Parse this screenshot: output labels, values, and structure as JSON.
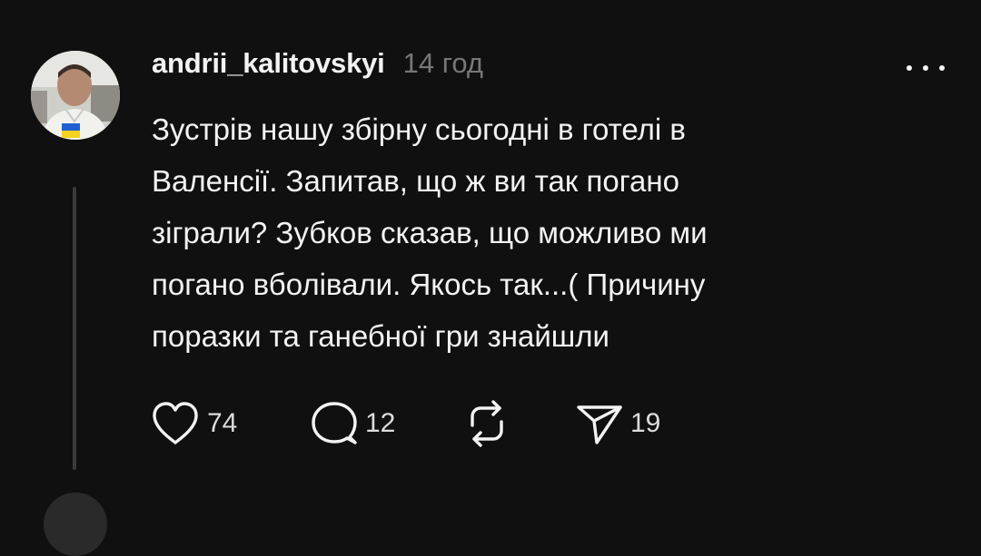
{
  "post": {
    "username": "andrii_kalitovskyi",
    "timestamp": "14 год",
    "text": "Зустрів нашу збірну сьогодні в готелі в\nВаленсії. Запитав, що ж ви так погано\nзіграли? Зубков сказав, що можливо ми\nпогано вболівали. Якось так...( Причину\nпоразки та ганебної гри знайшли",
    "icons": {
      "more": "more-horizontal-icon",
      "like": "heart-icon",
      "reply": "comment-icon",
      "repost": "repost-icon",
      "share": "send-icon"
    },
    "actions": {
      "likes": "74",
      "replies": "12",
      "shares": "19"
    }
  },
  "colors": {
    "background": "#101010",
    "text": "#f3f3f3",
    "muted": "#777777",
    "thread_line": "#3a3a3a"
  }
}
